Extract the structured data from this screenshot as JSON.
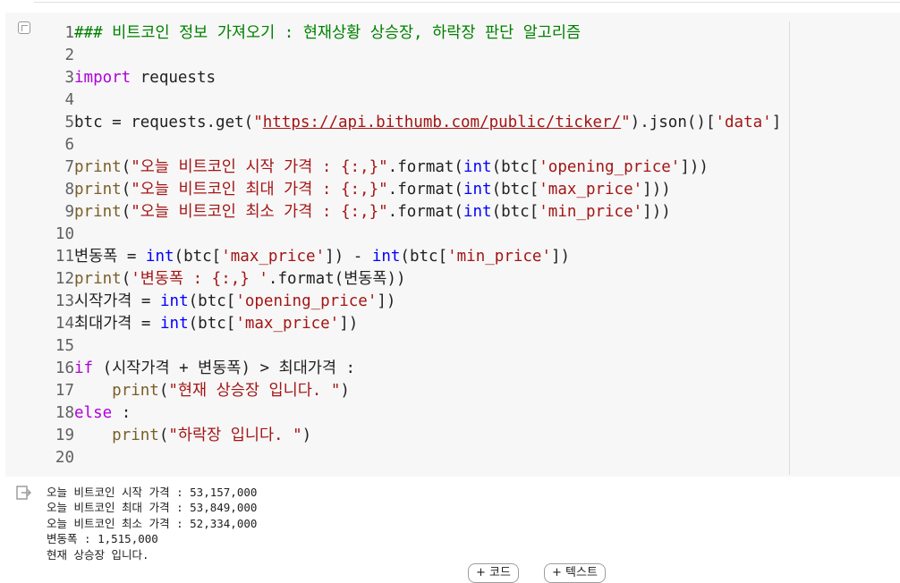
{
  "cell": {
    "lines": [
      {
        "n": "1",
        "tokens": [
          {
            "t": "### 비트코인 정보 가져오기 : 현재상황 상승장, 하락장 판단 알고리즘",
            "c": "c"
          }
        ]
      },
      {
        "n": "2",
        "tokens": []
      },
      {
        "n": "3",
        "tokens": [
          {
            "t": "import",
            "c": "k"
          },
          {
            "t": " requests",
            "c": ""
          }
        ]
      },
      {
        "n": "4",
        "tokens": []
      },
      {
        "n": "5",
        "tokens": [
          {
            "t": "btc = requests.get(",
            "c": ""
          },
          {
            "t": "\"",
            "c": "s"
          },
          {
            "t": "https://api.bithumb.com/public/ticker/",
            "c": "url"
          },
          {
            "t": "\"",
            "c": "s"
          },
          {
            "t": ").json()[",
            "c": ""
          },
          {
            "t": "'data'",
            "c": "s"
          },
          {
            "t": "]",
            "c": ""
          }
        ]
      },
      {
        "n": "6",
        "tokens": []
      },
      {
        "n": "7",
        "tokens": [
          {
            "t": "print",
            "c": "f"
          },
          {
            "t": "(",
            "c": ""
          },
          {
            "t": "\"오늘 비트코인 시작 가격 : {:,}\"",
            "c": "s"
          },
          {
            "t": ".format(",
            "c": ""
          },
          {
            "t": "int",
            "c": "b"
          },
          {
            "t": "(btc[",
            "c": ""
          },
          {
            "t": "'opening_price'",
            "c": "s"
          },
          {
            "t": "]))",
            "c": ""
          }
        ]
      },
      {
        "n": "8",
        "tokens": [
          {
            "t": "print",
            "c": "f"
          },
          {
            "t": "(",
            "c": ""
          },
          {
            "t": "\"오늘 비트코인 최대 가격 : {:,}\"",
            "c": "s"
          },
          {
            "t": ".format(",
            "c": ""
          },
          {
            "t": "int",
            "c": "b"
          },
          {
            "t": "(btc[",
            "c": ""
          },
          {
            "t": "'max_price'",
            "c": "s"
          },
          {
            "t": "]))",
            "c": ""
          }
        ]
      },
      {
        "n": "9",
        "tokens": [
          {
            "t": "print",
            "c": "f"
          },
          {
            "t": "(",
            "c": ""
          },
          {
            "t": "\"오늘 비트코인 최소 가격 : {:,}\"",
            "c": "s"
          },
          {
            "t": ".format(",
            "c": ""
          },
          {
            "t": "int",
            "c": "b"
          },
          {
            "t": "(btc[",
            "c": ""
          },
          {
            "t": "'min_price'",
            "c": "s"
          },
          {
            "t": "]))",
            "c": ""
          }
        ]
      },
      {
        "n": "10",
        "tokens": []
      },
      {
        "n": "11",
        "tokens": [
          {
            "t": "변동폭 = ",
            "c": ""
          },
          {
            "t": "int",
            "c": "b"
          },
          {
            "t": "(btc[",
            "c": ""
          },
          {
            "t": "'max_price'",
            "c": "s"
          },
          {
            "t": "]) - ",
            "c": ""
          },
          {
            "t": "int",
            "c": "b"
          },
          {
            "t": "(btc[",
            "c": ""
          },
          {
            "t": "'min_price'",
            "c": "s"
          },
          {
            "t": "])",
            "c": ""
          }
        ]
      },
      {
        "n": "12",
        "tokens": [
          {
            "t": "print",
            "c": "f"
          },
          {
            "t": "(",
            "c": ""
          },
          {
            "t": "'변동폭 : {:,} '",
            "c": "s"
          },
          {
            "t": ".format(변동폭))",
            "c": ""
          }
        ]
      },
      {
        "n": "13",
        "tokens": [
          {
            "t": "시작가격 = ",
            "c": ""
          },
          {
            "t": "int",
            "c": "b"
          },
          {
            "t": "(btc[",
            "c": ""
          },
          {
            "t": "'opening_price'",
            "c": "s"
          },
          {
            "t": "])",
            "c": ""
          }
        ]
      },
      {
        "n": "14",
        "tokens": [
          {
            "t": "최대가격 = ",
            "c": ""
          },
          {
            "t": "int",
            "c": "b"
          },
          {
            "t": "(btc[",
            "c": ""
          },
          {
            "t": "'max_price'",
            "c": "s"
          },
          {
            "t": "])",
            "c": ""
          }
        ]
      },
      {
        "n": "15",
        "tokens": []
      },
      {
        "n": "16",
        "tokens": [
          {
            "t": "if",
            "c": "k"
          },
          {
            "t": " (시작가격 + 변동폭) > 최대가격 :",
            "c": ""
          }
        ]
      },
      {
        "n": "17",
        "tokens": [
          {
            "t": "    ",
            "c": ""
          },
          {
            "t": "print",
            "c": "f"
          },
          {
            "t": "(",
            "c": ""
          },
          {
            "t": "\"현재 상승장 입니다. \"",
            "c": "s"
          },
          {
            "t": ")",
            "c": ""
          }
        ]
      },
      {
        "n": "18",
        "tokens": [
          {
            "t": "else",
            "c": "k"
          },
          {
            "t": " :",
            "c": ""
          }
        ]
      },
      {
        "n": "19",
        "tokens": [
          {
            "t": "    ",
            "c": ""
          },
          {
            "t": "print",
            "c": "f"
          },
          {
            "t": "(",
            "c": ""
          },
          {
            "t": "\"하락장 입니다. \"",
            "c": "s"
          },
          {
            "t": ")",
            "c": ""
          }
        ]
      },
      {
        "n": "20",
        "tokens": []
      }
    ]
  },
  "output": {
    "icon": "output-icon",
    "text": "오늘 비트코인 시작 가격 : 53,157,000\n오늘 비트코인 최대 가격 : 53,849,000\n오늘 비트코인 최소 가격 : 52,334,000\n변동폭 : 1,515,000\n현재 상승장 입니다."
  },
  "toolbar": {
    "add_code_label": "+ 코드",
    "add_text_label": "+ 텍스트"
  },
  "colors": {
    "keyword": "#af00db",
    "function": "#795e26",
    "builtin": "#0000ff",
    "string": "#a31515",
    "comment": "#008000"
  }
}
